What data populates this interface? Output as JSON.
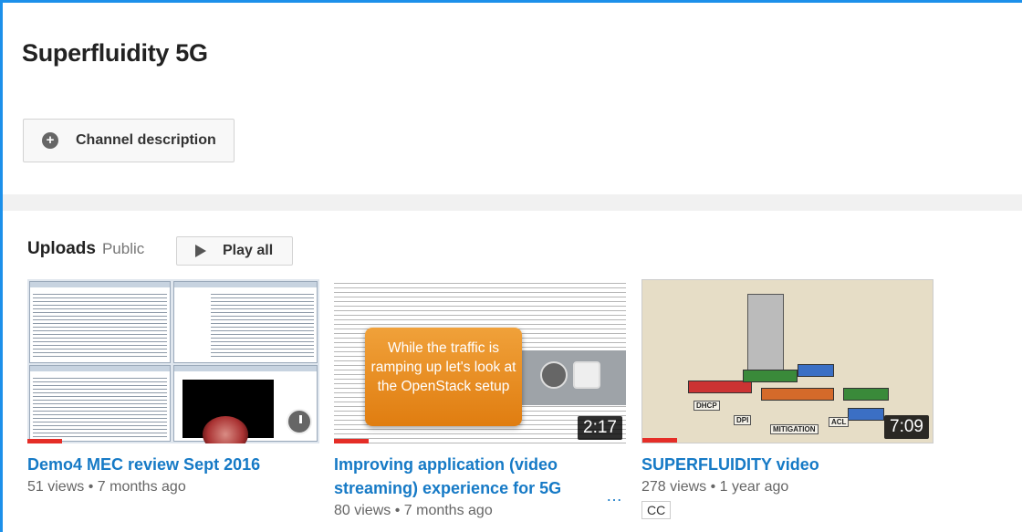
{
  "channel": {
    "title": "Superfluidity 5G",
    "description_button": "Channel description"
  },
  "uploads": {
    "title": "Uploads",
    "visibility": "Public",
    "play_all_label": "Play all"
  },
  "videos": [
    {
      "title": "Demo4 MEC review Sept 2016",
      "views": "51 views",
      "age": "7 months ago",
      "watched_fraction": 0.12
    },
    {
      "title": "Improving application (video streaming) experience for 5G",
      "ellipsis": "…",
      "views": "80 views",
      "age": "7 months ago",
      "duration": "2:17",
      "watched_fraction": 0.12,
      "thumb_caption": "While the traffic is ramping up let's look at the OpenStack setup"
    },
    {
      "title": "SUPERFLUIDITY video",
      "views": "278 views",
      "age": "1 year ago",
      "duration": "7:09",
      "badge": "CC",
      "watched_fraction": 0.12,
      "thumb_signs": [
        "DHCP",
        "DPI",
        "MITIGATION",
        "ACL"
      ]
    }
  ],
  "separator": "•",
  "colors": {
    "accent_border": "#1c90ea",
    "link": "#167ac6",
    "progress": "#e52d27"
  },
  "icons": {
    "description_button": "plus-circle-icon",
    "play_all": "play-icon",
    "watch_later": "clock-icon"
  }
}
